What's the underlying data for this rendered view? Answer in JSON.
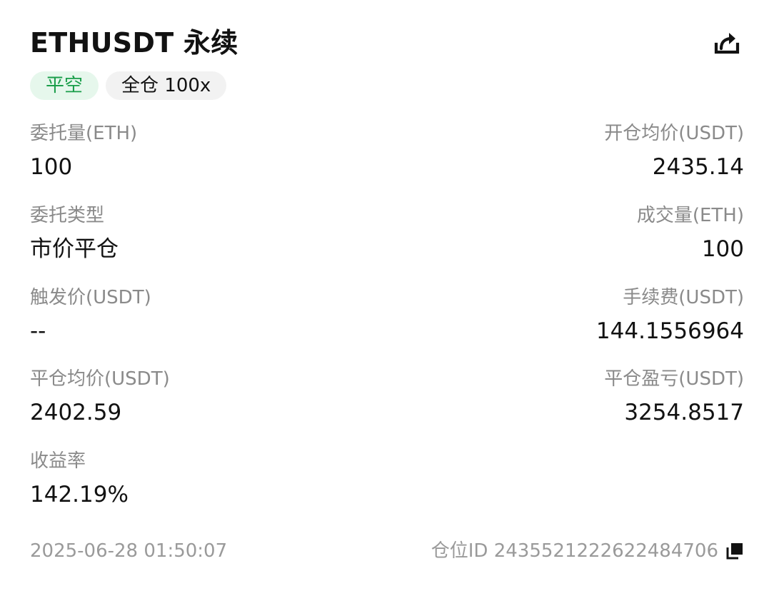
{
  "header": {
    "title": "ETHUSDT 永续",
    "share_icon": "share-icon"
  },
  "badges": {
    "side": "平空",
    "margin_mode": "全仓 100x"
  },
  "colors": {
    "side_text": "#1a9e4a",
    "side_bg": "#e6f7ec",
    "mode_bg": "#f2f2f2",
    "label": "#8a8a8a",
    "value": "#121212"
  },
  "fields": {
    "order_qty": {
      "label": "委托量(ETH)",
      "value": "100"
    },
    "open_avg_price": {
      "label": "开仓均价(USDT)",
      "value": "2435.14"
    },
    "order_type": {
      "label": "委托类型",
      "value": "市价平仓"
    },
    "filled_qty": {
      "label": "成交量(ETH)",
      "value": "100"
    },
    "trigger_price": {
      "label": "触发价(USDT)",
      "value": "--"
    },
    "fee": {
      "label": "手续费(USDT)",
      "value": "144.1556964"
    },
    "close_avg_price": {
      "label": "平仓均价(USDT)",
      "value": "2402.59"
    },
    "close_pnl": {
      "label": "平仓盈亏(USDT)",
      "value": "3254.8517"
    },
    "roi": {
      "label": "收益率",
      "value": "142.19%"
    }
  },
  "footer": {
    "timestamp": "2025-06-28 01:50:07",
    "position_id": "仓位ID 2435521222622484706",
    "copy_icon": "copy-icon"
  }
}
